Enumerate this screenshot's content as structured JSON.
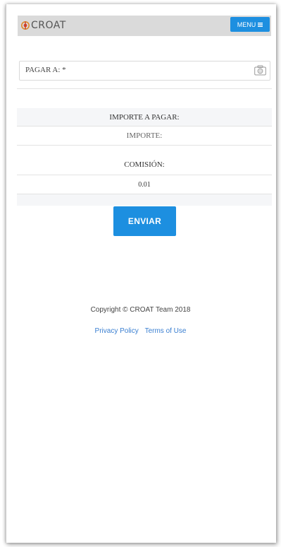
{
  "header": {
    "logo_text": "CROAT",
    "menu_label": "MENU",
    "colors": {
      "accent": "#1d8fe0",
      "bar": "#dadada"
    }
  },
  "form": {
    "pay_to_label": "PAGAR A: *",
    "pay_to_value": "",
    "camera_icon": "camera-icon",
    "amount_heading": "IMPORTE A PAGAR:",
    "amount_placeholder": "IMPORTE:",
    "fee_heading": "COMISIÓN:",
    "fee_value": "0.01",
    "submit_label": "ENVIAR"
  },
  "footer": {
    "copyright": "Copyright © CROAT Team 2018",
    "privacy_label": "Privacy Policy",
    "terms_label": "Terms of Use"
  }
}
